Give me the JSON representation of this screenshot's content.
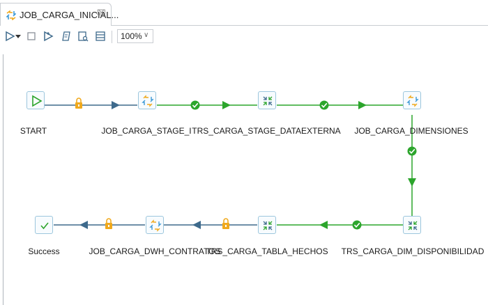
{
  "tab": {
    "title": "JOB_CARGA_INICIAL...",
    "close": "⌧",
    "icon": "job-icon"
  },
  "toolbar": {
    "zoom": "100%",
    "buttons": [
      "run-icon",
      "dropdown-icon",
      "stop-icon",
      "debug-run-icon",
      "script-icon",
      "sql-icon",
      "grid-icon"
    ]
  },
  "nodes": [
    {
      "label": "START",
      "kind": "start"
    },
    {
      "label": "JOB_CARGA_STAGE_I",
      "kind": "job"
    },
    {
      "label": "TRS_CARGA_STAGE_DATAEXTERNA",
      "kind": "transform"
    },
    {
      "label": "JOB_CARGA_DIMENSIONES",
      "kind": "job"
    },
    {
      "label": "TRS_CARGA_DIM_DISPONIBILIDAD",
      "kind": "transform"
    },
    {
      "label": "TRS_CARGA_TABLA_HECHOS",
      "kind": "transform"
    },
    {
      "label": "JOB_CARGA_DWH_CONTRATOS",
      "kind": "job"
    },
    {
      "label": "Success",
      "kind": "success"
    }
  ],
  "links": [
    {
      "from": "START",
      "to": "JOB_CARGA_STAGE_I",
      "type": "unconditional"
    },
    {
      "from": "JOB_CARGA_STAGE_I",
      "to": "TRS_CARGA_STAGE_DATAEXTERNA",
      "type": "success"
    },
    {
      "from": "TRS_CARGA_STAGE_DATAEXTERNA",
      "to": "JOB_CARGA_DIMENSIONES",
      "type": "success"
    },
    {
      "from": "JOB_CARGA_DIMENSIONES",
      "to": "TRS_CARGA_DIM_DISPONIBILIDAD",
      "type": "success"
    },
    {
      "from": "TRS_CARGA_DIM_DISPONIBILIDAD",
      "to": "TRS_CARGA_TABLA_HECHOS",
      "type": "success"
    },
    {
      "from": "TRS_CARGA_TABLA_HECHOS",
      "to": "JOB_CARGA_DWH_CONTRATOS",
      "type": "unconditional"
    },
    {
      "from": "JOB_CARGA_DWH_CONTRATOS",
      "to": "Success",
      "type": "unconditional"
    }
  ],
  "colors": {
    "success": "#2ca52c",
    "unconditional": "#3e6a8c",
    "lock": "#f0a91d",
    "node_border": "#9cc6dd"
  }
}
